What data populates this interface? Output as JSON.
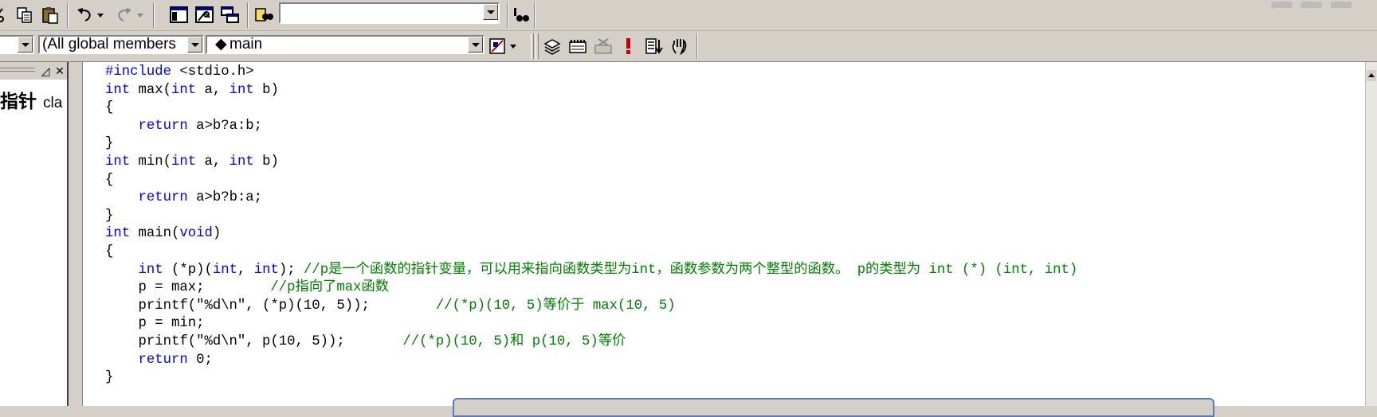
{
  "toolbar1": {
    "buttons": [
      "cut-icon",
      "copy-icon",
      "paste-icon",
      "undo-icon",
      "redo-icon",
      "workspace-icon",
      "output-icon",
      "window-list-icon",
      "find-in-files-icon",
      "find-icon"
    ],
    "find_combo_value": ""
  },
  "toolbar2": {
    "class_combo": "",
    "members_combo": "(All global members",
    "function_combo": "main",
    "buttons": [
      "wizard-action-icon",
      "compile-icon",
      "build-icon",
      "stop-build-icon",
      "execute-icon",
      "go-icon",
      "breakpoint-icon"
    ]
  },
  "workspace": {
    "tree_item": "指针",
    "tree_item_suffix": "cla"
  },
  "editor": {
    "lines": [
      [
        {
          "t": "#include",
          "c": "pp"
        },
        {
          "t": " <stdio.h>"
        }
      ],
      [
        {
          "t": "int",
          "c": "kw"
        },
        {
          "t": " max("
        },
        {
          "t": "int",
          "c": "kw"
        },
        {
          "t": " a, "
        },
        {
          "t": "int",
          "c": "kw"
        },
        {
          "t": " b)"
        }
      ],
      [
        {
          "t": "{"
        }
      ],
      [
        {
          "t": "    "
        },
        {
          "t": "return",
          "c": "kw"
        },
        {
          "t": " a>b?a:b;"
        }
      ],
      [
        {
          "t": "}"
        }
      ],
      [
        {
          "t": "int",
          "c": "kw"
        },
        {
          "t": " min("
        },
        {
          "t": "int",
          "c": "kw"
        },
        {
          "t": " a, "
        },
        {
          "t": "int",
          "c": "kw"
        },
        {
          "t": " b)"
        }
      ],
      [
        {
          "t": "{"
        }
      ],
      [
        {
          "t": "    "
        },
        {
          "t": "return",
          "c": "kw"
        },
        {
          "t": " a>b?b:a;"
        }
      ],
      [
        {
          "t": "}"
        }
      ],
      [
        {
          "t": "int",
          "c": "kw"
        },
        {
          "t": " main("
        },
        {
          "t": "void",
          "c": "kw"
        },
        {
          "t": ")"
        }
      ],
      [
        {
          "t": "{"
        }
      ],
      [
        {
          "t": "    "
        },
        {
          "t": "int",
          "c": "kw"
        },
        {
          "t": " (*p)("
        },
        {
          "t": "int",
          "c": "kw"
        },
        {
          "t": ", "
        },
        {
          "t": "int",
          "c": "kw"
        },
        {
          "t": "); "
        },
        {
          "t": "//p是一个函数的指针变量，可以用来指向函数类型为int，函数参数为两个整型的函数。 p的类型为 int (*) (int, int)",
          "c": "cm"
        }
      ],
      [
        {
          "t": "    p = max;        "
        },
        {
          "t": "//p指向了max函数",
          "c": "cm"
        }
      ],
      [
        {
          "t": "    printf(\"%d\\n\", (*p)(10, 5));        "
        },
        {
          "t": "//(*p)(10, 5)等价于 max(10, 5)",
          "c": "cm"
        }
      ],
      [
        {
          "t": "    p = min;"
        }
      ],
      [
        {
          "t": "    printf(\"%d\\n\", p(10, 5));       "
        },
        {
          "t": "//(*p)(10, 5)和 p(10, 5)等价",
          "c": "cm"
        }
      ],
      [
        {
          "t": "    "
        },
        {
          "t": "return",
          "c": "kw"
        },
        {
          "t": " 0;"
        }
      ],
      [
        {
          "t": "}"
        }
      ]
    ]
  },
  "colors": {
    "keyword": "#0000ff",
    "comment": "#008000",
    "chrome": "#d4d0c8"
  }
}
